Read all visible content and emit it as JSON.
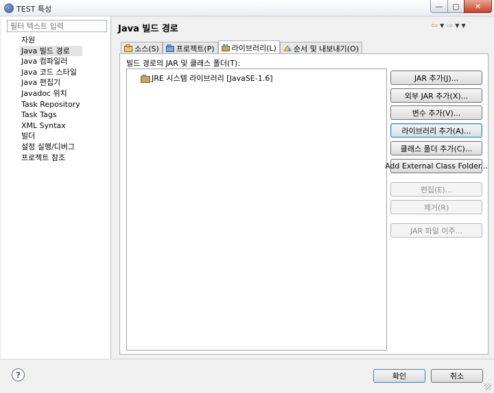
{
  "window": {
    "title": "TEST 특성",
    "controls": {
      "minimize": "—",
      "maximize": "▢",
      "close": "✕"
    }
  },
  "sidebar": {
    "filter_placeholder": "필터 텍스트 입력",
    "items": [
      {
        "label": "자원"
      },
      {
        "label": "Java 빌드 경로",
        "selected": true
      },
      {
        "label": "Java 컴파일러"
      },
      {
        "label": "Java 코드 스타일"
      },
      {
        "label": "Java 편집기"
      },
      {
        "label": "Javadoc 위치"
      },
      {
        "label": "Task Repository"
      },
      {
        "label": "Task Tags"
      },
      {
        "label": "XML Syntax"
      },
      {
        "label": "빌더"
      },
      {
        "label": "설정 실행/디버그"
      },
      {
        "label": "프로젝트 참조"
      }
    ]
  },
  "header": {
    "title": "Java 빌드 경로",
    "nav": {
      "back": "⇦",
      "forward": "⇨",
      "caret": "▼",
      "menu": "▼"
    }
  },
  "tabs": [
    {
      "label": "소스(S)",
      "icon": "source-folder-icon"
    },
    {
      "label": "프로젝트(P)",
      "icon": "project-icon"
    },
    {
      "label": "라이브러리(L)",
      "icon": "library-icon",
      "active": true
    },
    {
      "label": "순서 및 내보내기(O)",
      "icon": "order-export-icon"
    }
  ],
  "libraries": {
    "label": "빌드 경로의 JAR 및 클래스 폴더(T):",
    "entries": [
      {
        "label": "JRE 시스템 라이브러리 [JavaSE-1.6]",
        "icon": "jar-library-icon"
      }
    ],
    "buttons": [
      {
        "label": "JAR 추가(J)...",
        "enabled": true
      },
      {
        "label": "외부 JAR 추가(X)...",
        "enabled": true
      },
      {
        "label": "변수 추가(V)...",
        "enabled": true
      },
      {
        "label": "라이브러리 추가(A)...",
        "enabled": true,
        "focused": true
      },
      {
        "label": "클래스 폴더 추가(C)...",
        "enabled": true
      },
      {
        "label": "Add External Class Folder...",
        "enabled": true
      },
      {
        "label": "편집(E)...",
        "enabled": false
      },
      {
        "label": "제거(R)",
        "enabled": false
      },
      {
        "label": "JAR 파일 이주...",
        "enabled": false
      }
    ]
  },
  "footer": {
    "help": "?",
    "ok": "확인",
    "cancel": "취소"
  }
}
